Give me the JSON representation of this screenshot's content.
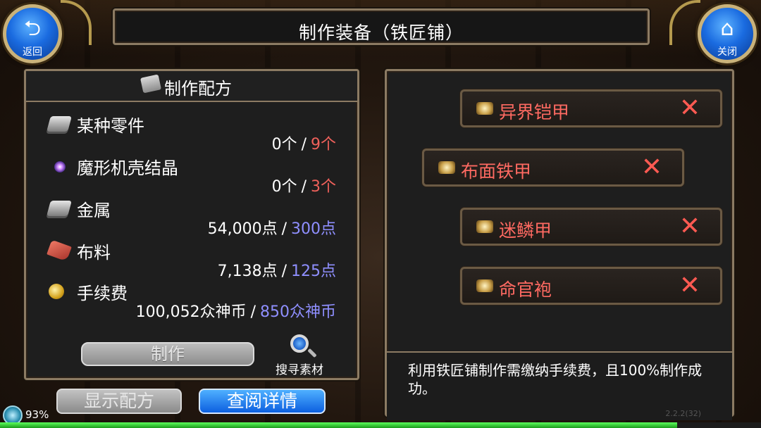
{
  "header": {
    "title": "制作装备（铁匠铺）",
    "back_label": "返回",
    "close_label": "关闭"
  },
  "recipe_panel": {
    "title": "制作配方",
    "materials": [
      {
        "name": "某种零件",
        "icon": "metal-part-icon",
        "have": "0个",
        "need": "9个",
        "need_color": "#f0615b"
      },
      {
        "name": "魔形机壳结晶",
        "icon": "crystal-orb-icon",
        "have": "0个",
        "need": "3个",
        "need_color": "#f0615b"
      },
      {
        "name": "金属",
        "icon": "metal-ingot-icon",
        "have": "54,000点",
        "need": "300点",
        "need_color": "#8f8fff"
      },
      {
        "name": "布料",
        "icon": "cloth-icon",
        "have": "7,138点",
        "need": "125点",
        "need_color": "#8f8fff"
      },
      {
        "name": "手续费",
        "icon": "coin-icon",
        "have": "100,052众神币",
        "need": "850众神币",
        "need_color": "#8f8fff"
      }
    ],
    "craft_label": "制作",
    "search_label": "搜寻素材"
  },
  "bottom_buttons": {
    "show_recipe": "显示配方",
    "view_detail": "查阅详情"
  },
  "equipment_list": {
    "items": [
      {
        "name": "异界铠甲",
        "selected": false
      },
      {
        "name": "布面铁甲",
        "selected": true
      },
      {
        "name": "迷鳞甲",
        "selected": false
      },
      {
        "name": "命官袍",
        "selected": false
      }
    ],
    "info_text": "利用铁匠铺制作需缴纳手续费，且100%制作成功。",
    "version": "2.2.2(32)"
  },
  "status": {
    "battery": "93%",
    "battery_level": 0.93,
    "hp_level": 0.89
  },
  "colors": {
    "accent_blue": "#1a6be0",
    "frame": "#8c7b63",
    "item_text": "#ff6a62"
  }
}
